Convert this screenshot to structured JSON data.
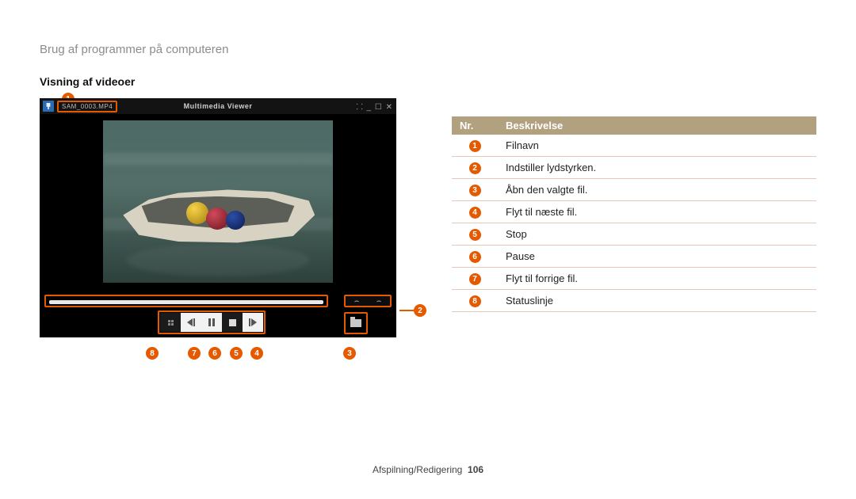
{
  "header": "Brug af programmer på computeren",
  "section_title": "Visning af videoer",
  "player": {
    "filename": "SAM_0003.MP4",
    "app_title": "Multimedia Viewer",
    "window_controls": "⸬  _  ☐  ✕"
  },
  "markers": {
    "m1": "1",
    "m2": "2",
    "m3": "3",
    "m4": "4",
    "m5": "5",
    "m6": "6",
    "m7": "7",
    "m8": "8"
  },
  "table": {
    "header_nr": "Nr.",
    "header_desc": "Beskrivelse",
    "rows": [
      {
        "n": "1",
        "d": "Filnavn"
      },
      {
        "n": "2",
        "d": "Indstiller lydstyrken."
      },
      {
        "n": "3",
        "d": "Åbn den valgte fil."
      },
      {
        "n": "4",
        "d": "Flyt til næste fil."
      },
      {
        "n": "5",
        "d": "Stop"
      },
      {
        "n": "6",
        "d": "Pause"
      },
      {
        "n": "7",
        "d": "Flyt til forrige fil."
      },
      {
        "n": "8",
        "d": "Statuslinje"
      }
    ]
  },
  "footer": {
    "section": "Afspilning/Redigering",
    "page": "106"
  }
}
